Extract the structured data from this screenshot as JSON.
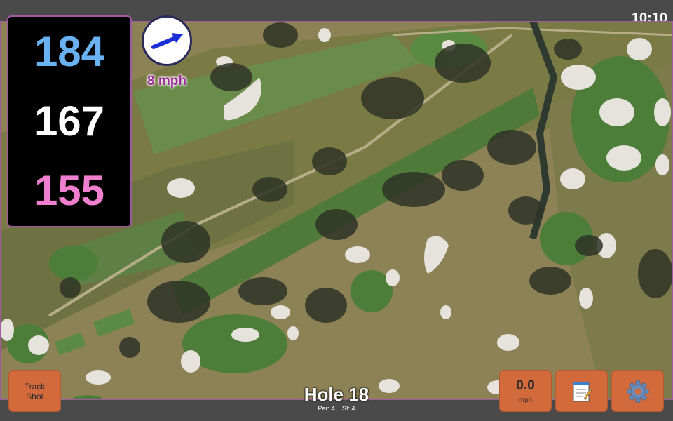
{
  "status": {
    "time": "10:10"
  },
  "yardages": {
    "back": "184",
    "center": "167",
    "front": "155"
  },
  "colors": {
    "back": "#6ab1f1",
    "center": "#ffffff",
    "front": "#f07fcf",
    "button": "#d36a3c",
    "frame": "#a05aa0"
  },
  "wind": {
    "speed_label": "8 mph",
    "icon": "wind-direction-arrow"
  },
  "hole": {
    "title": "Hole 18",
    "par": "Par: 4",
    "si": "SI: 4"
  },
  "buttons": {
    "track_line1": "Track",
    "track_line2": "Shot",
    "speed_value": "0.0",
    "speed_unit": "mph",
    "notes_icon": "notepad-icon",
    "settings_icon": "gear-icon"
  }
}
